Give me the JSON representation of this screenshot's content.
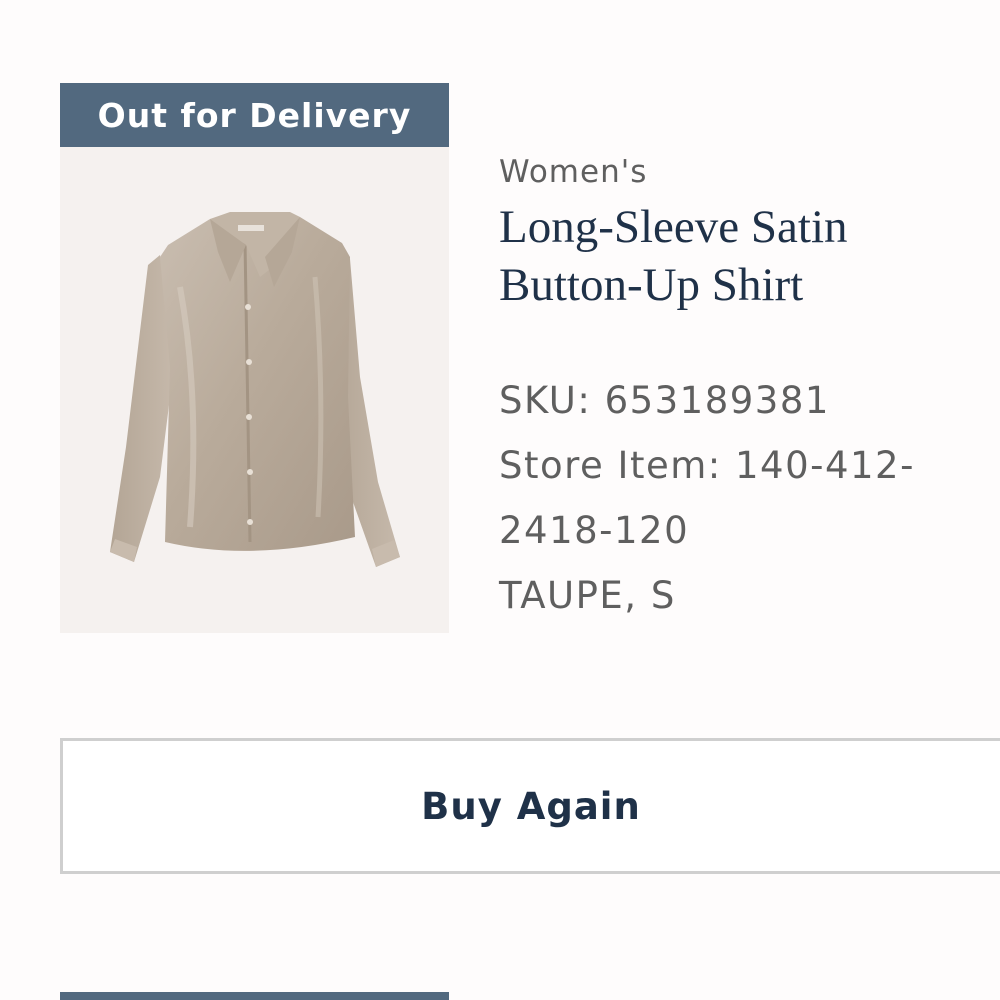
{
  "order_item": {
    "status": "Out for Delivery",
    "image_icon": "satin-shirt-image",
    "category": "Women's",
    "name_line1": "Long-Sleeve Satin",
    "name_line2": "Button-Up Shirt",
    "sku": "SKU: 653189381",
    "store_item_line1": "Store Item: 140-412-",
    "store_item_line2": "2418-120",
    "color_size": "TAUPE, S"
  },
  "actions": {
    "buy_again_label": "Buy Again"
  },
  "colors": {
    "banner": "#52697f",
    "title": "#1f3148",
    "muted_text": "#5f5f5f"
  }
}
